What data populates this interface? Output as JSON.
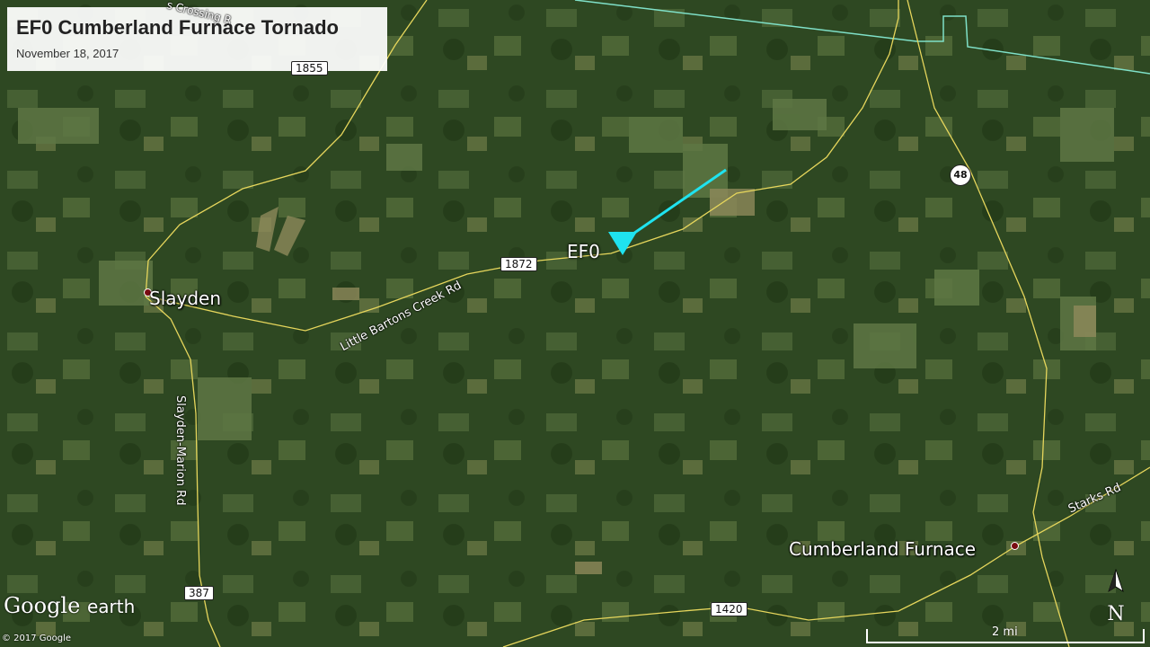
{
  "title": {
    "heading": "EF0 Cumberland Furnace Tornado",
    "date": "November 18, 2017"
  },
  "places": {
    "slayden": "Slayden",
    "cumberland_furnace": "Cumberland Furnace"
  },
  "roads": {
    "little_bartons_creek": "Little Bartons Creek Rd",
    "slayden_marion": "Slayden-Marion Rd",
    "starks": "Starks Rd",
    "crossing_partial": "s Crossing R"
  },
  "shields": {
    "r1855": "1855",
    "r1872": "1872",
    "r48": "48",
    "r387": "387",
    "r1420": "1420"
  },
  "tornado": {
    "rating": "EF0",
    "track_color": "#1fe3ef"
  },
  "branding": {
    "google": "Google",
    "earth": "earth",
    "copyright": "© 2017 Google"
  },
  "compass": {
    "north": "N",
    "north_arrow_icon": "north-arrow-icon"
  },
  "scale": {
    "label": "2 mi"
  },
  "colors": {
    "boundary": "#7fe0c8",
    "road": "#e6d65c",
    "town_marker": "#7a0c12"
  }
}
